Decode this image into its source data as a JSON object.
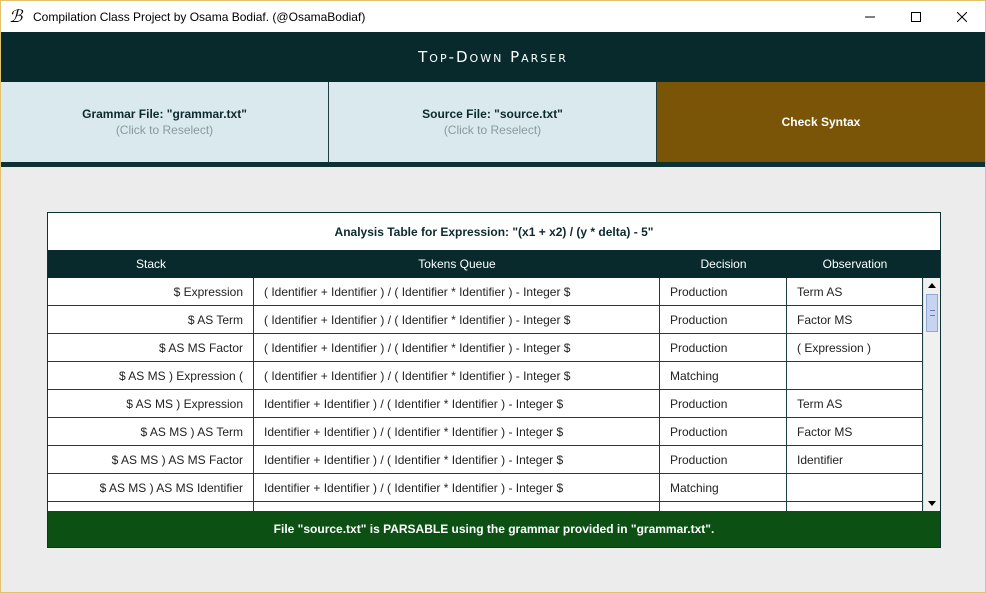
{
  "window": {
    "title": "Compilation Class Project by Osama Bodiaf. (@OsamaBodiaf)",
    "app_icon": "OB",
    "controls": {
      "minimize": "—",
      "maximize": "☐",
      "close": "✕"
    }
  },
  "header": {
    "title": "Top-Down Parser"
  },
  "buttons": {
    "grammar": {
      "label": "Grammar File: \"grammar.txt\"",
      "sub": "(Click to Reselect)"
    },
    "source": {
      "label": "Source File: \"source.txt\"",
      "sub": "(Click to Reselect)"
    },
    "check": {
      "label": "Check Syntax"
    }
  },
  "colors": {
    "header": "#082a2c",
    "file_button": "#d9e9ee",
    "check_button": "#7a5507",
    "status_ok": "#0c5014"
  },
  "table": {
    "caption": "Analysis Table for Expression: \"(x1 + x2) / (y * delta) - 5\"",
    "columns": [
      "Stack",
      "Tokens Queue",
      "Decision",
      "Observation"
    ],
    "rows": [
      [
        "$ Expression",
        "( Identifier + Identifier ) / ( Identifier * Identifier ) - Integer $",
        "Production",
        "Term AS"
      ],
      [
        "$ AS Term",
        "( Identifier + Identifier ) / ( Identifier * Identifier ) - Integer $",
        "Production",
        "Factor MS"
      ],
      [
        "$ AS MS Factor",
        "( Identifier + Identifier ) / ( Identifier * Identifier ) - Integer $",
        "Production",
        "( Expression )"
      ],
      [
        "$ AS MS ) Expression (",
        "( Identifier + Identifier ) / ( Identifier * Identifier ) - Integer $",
        "Matching",
        ""
      ],
      [
        "$ AS MS ) Expression",
        "Identifier + Identifier ) / ( Identifier * Identifier ) - Integer $",
        "Production",
        "Term AS"
      ],
      [
        "$ AS MS ) AS Term",
        "Identifier + Identifier ) / ( Identifier * Identifier ) - Integer $",
        "Production",
        "Factor MS"
      ],
      [
        "$ AS MS ) AS MS Factor",
        "Identifier + Identifier ) / ( Identifier * Identifier ) - Integer $",
        "Production",
        "Identifier"
      ],
      [
        "$ AS MS ) AS MS Identifier",
        "Identifier + Identifier ) / ( Identifier * Identifier ) - Integer $",
        "Matching",
        ""
      ],
      [
        "",
        "",
        "",
        ""
      ]
    ]
  },
  "status": {
    "message": "File \"source.txt\" is PARSABLE using the grammar provided in \"grammar.txt\"."
  }
}
